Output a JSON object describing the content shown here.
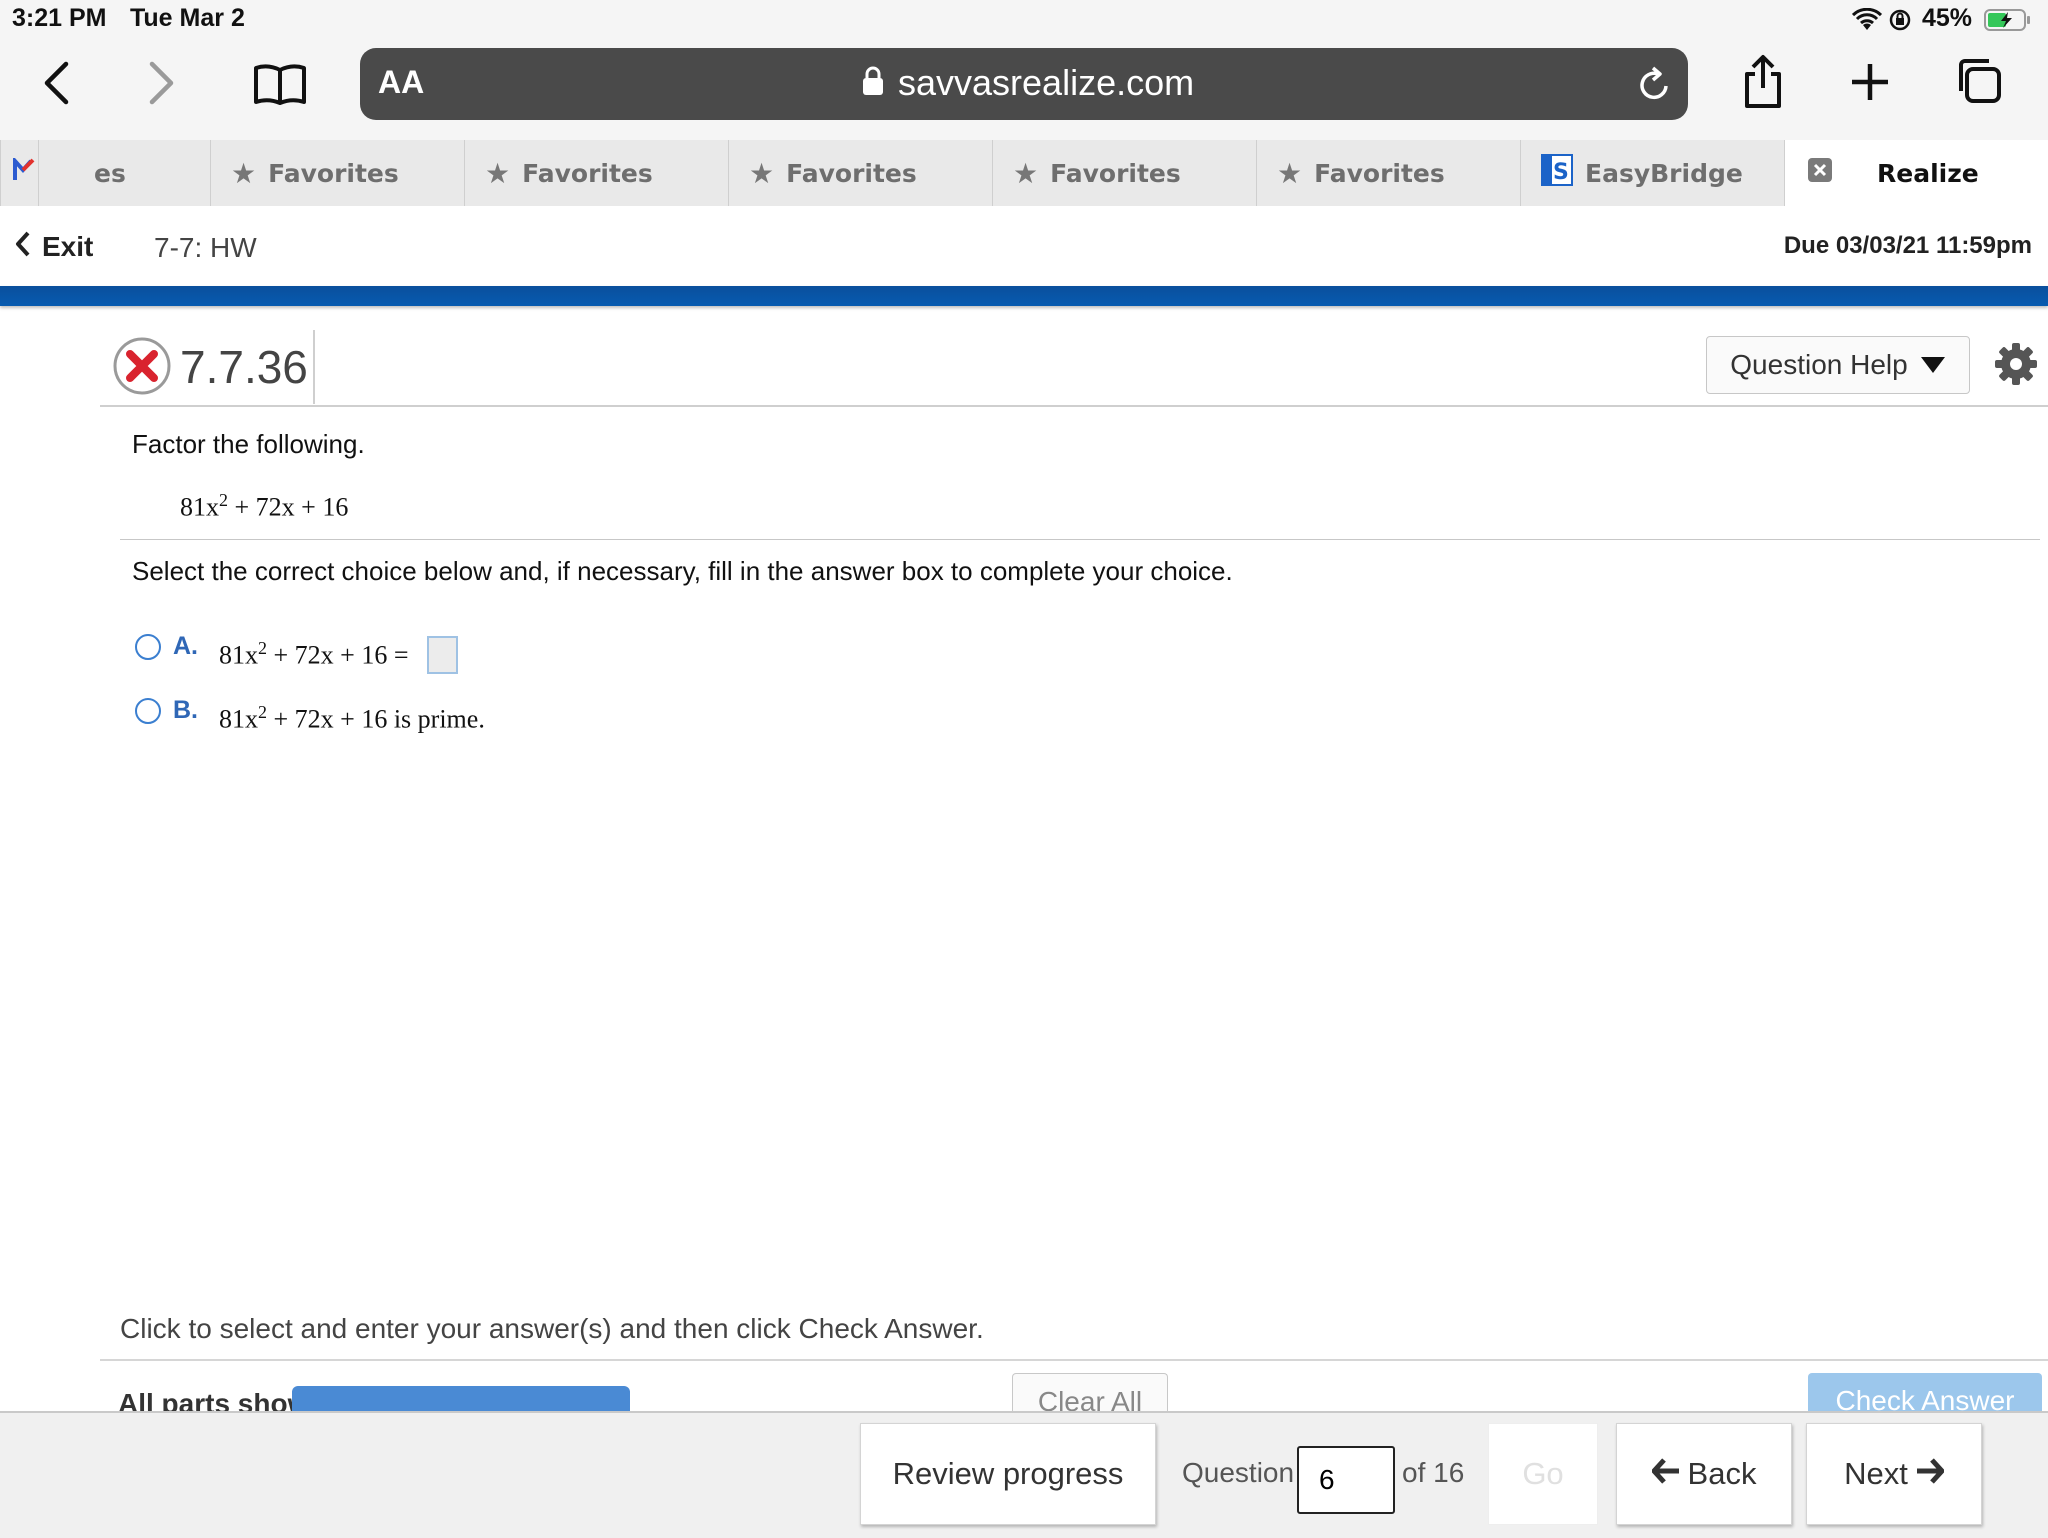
{
  "status_bar": {
    "time": "3:21 PM",
    "date": "Tue Mar 2",
    "battery": "45%"
  },
  "browser": {
    "text_size_label": "AA",
    "url": "savvasrealize.com",
    "tabs": [
      {
        "label": "es"
      },
      {
        "label": "Favorites"
      },
      {
        "label": "Favorites"
      },
      {
        "label": "Favorites"
      },
      {
        "label": "Favorites"
      },
      {
        "label": "Favorites"
      },
      {
        "label": "EasyBridge"
      },
      {
        "label": "Realize"
      }
    ]
  },
  "assignment": {
    "exit_label": "Exit",
    "title": "7-7: HW",
    "due": "Due 03/03/21 11:59pm"
  },
  "question": {
    "number": "7.7.36",
    "help_label": "Question Help",
    "prompt": "Factor the following.",
    "expr_coef": "81x",
    "expr_exp": "2",
    "expr_rest": "+ 72x + 16",
    "instruction": "Select the correct choice below and, if necessary, fill in the answer box to complete your choice.",
    "choices": [
      {
        "letter": "A.",
        "coef": "81x",
        "exp": "2",
        "rest": "+ 72x + 16 ="
      },
      {
        "letter": "B.",
        "coef": "81x",
        "exp": "2",
        "rest": "+ 72x + 16 is prime."
      }
    ]
  },
  "bottom": {
    "help_text": "Click to select and enter your answer(s) and then click Check Answer.",
    "parts_label": "All parts showing",
    "clear_all": "Clear All",
    "check_answer": "Check Answer"
  },
  "footer": {
    "review_label": "Review progress",
    "question_label": "Question",
    "question_value": "6",
    "of_label": "of 16",
    "go_label": "Go",
    "back_label": "Back",
    "next_label": "Next"
  },
  "colors": {
    "accent_blue": "#075bb0",
    "wrong_red": "#d9232e",
    "choice_blue": "#2f67b6"
  }
}
